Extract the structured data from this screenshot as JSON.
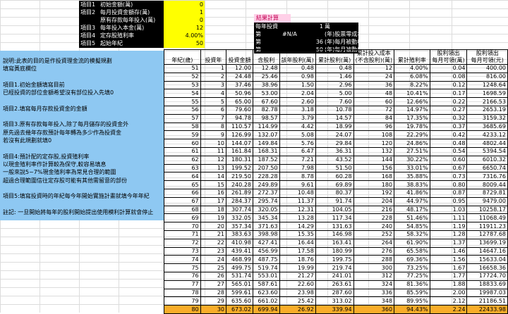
{
  "params": [
    {
      "label": "項目1",
      "name": "初始金額(萬)",
      "value": "0"
    },
    {
      "label": "項目2",
      "name": "每月投資金額存(萬)",
      "value": "1"
    },
    {
      "label": "",
      "name": "原有存款每年投入(萬)",
      "value": "0"
    },
    {
      "label": "項目3",
      "name": "每年投入本金(萬)",
      "value": "12"
    },
    {
      "label": "項目4",
      "name": "定存股殖利率",
      "value": "4.00%"
    },
    {
      "label": "項目5",
      "name": "起始年紀",
      "value": "50"
    }
  ],
  "result": {
    "title": "結果計算",
    "rows": [
      {
        "c1": "每年投資",
        "c2": "",
        "c3": "1",
        "c4": "萬"
      },
      {
        "c1": "第",
        "c2": "#N/A",
        "c3": "",
        "c4": "(年)股票零成本"
      },
      {
        "c1": "第",
        "c2": "",
        "c3": "36",
        "c4": "(年)每月被動收入大於3萬"
      },
      {
        "c1": "第",
        "c2": "",
        "c3": "50",
        "c4": "(年)每月被動收入大於5萬"
      }
    ]
  },
  "notes": [
    "說明:此表的目的是作投資理金流的模擬規劃",
    "填寫黃底欄位",
    "",
    "項目1.初始金額填寫目前",
    "已經投資的部位金額希望沒有部位投入先填0",
    "",
    "項目2.填寫每月存款投資金的金額",
    "",
    "項目3.原有存款每年投入,除了每月儲存的投資金外",
    "原先過去幾年存款預計每年轉為多少作為投資金",
    "若沒有此規劃就填0",
    "",
    "項目4:預計配的定存股,投資殖利率",
    "以現金殖利率作計算較為保守,較容易填息",
    "一般來說5~7%現金殖利率為常見合理的範圍",
    "超過合理範圍信往定存股可能有其他需留意的部份",
    "",
    "項目5:填寫投資時的年紀每今年開始實施計畫就填今年年紀",
    "",
    "註記: 一旦開始將每年的股利開始提出使用模利計算就會停止"
  ],
  "headers": [
    "年紀(歲)",
    "投資年",
    "投資金額",
    "含股利",
    "該年股利(萬)",
    "累計股利(萬)",
    "累計投入成本\n(不含股利)(萬)",
    "累計殖利率",
    "股利領出\n每月可領(萬)",
    "股利領出\n每月可領(元)"
  ],
  "rows": [
    [
      "51",
      "1",
      "12.00",
      "12.48",
      "0.48",
      "0.48",
      "12",
      "4.00%",
      "0.04",
      "400.00"
    ],
    [
      "52",
      "2",
      "24.48",
      "25.46",
      "0.98",
      "1.46",
      "24",
      "6.08%",
      "0.08",
      "816.00"
    ],
    [
      "53",
      "3",
      "37.46",
      "38.96",
      "1.50",
      "2.96",
      "36",
      "8.22%",
      "0.12",
      "1248.64"
    ],
    [
      "54",
      "4",
      "50.96",
      "53.00",
      "2.04",
      "5.00",
      "48",
      "10.41%",
      "0.17",
      "1698.59"
    ],
    [
      "55",
      "5",
      "65.00",
      "67.60",
      "2.60",
      "7.60",
      "60",
      "12.66%",
      "0.22",
      "2166.53"
    ],
    [
      "56",
      "6",
      "79.60",
      "82.78",
      "3.18",
      "10.78",
      "72",
      "14.97%",
      "0.27",
      "2653.19"
    ],
    [
      "57",
      "7",
      "94.78",
      "98.57",
      "3.79",
      "14.57",
      "84",
      "17.35%",
      "0.32",
      "3159.32"
    ],
    [
      "58",
      "8",
      "110.57",
      "114.99",
      "4.42",
      "18.99",
      "96",
      "19.78%",
      "0.37",
      "3685.69"
    ],
    [
      "59",
      "9",
      "126.99",
      "132.07",
      "5.08",
      "24.07",
      "108",
      "22.29%",
      "0.42",
      "4233.12"
    ],
    [
      "60",
      "10",
      "144.07",
      "149.84",
      "5.76",
      "29.84",
      "120",
      "24.86%",
      "0.48",
      "4802.44"
    ],
    [
      "61",
      "11",
      "161.84",
      "168.31",
      "6.47",
      "36.31",
      "132",
      "27.51%",
      "0.54",
      "5394.54"
    ],
    [
      "62",
      "12",
      "180.31",
      "187.52",
      "7.21",
      "43.52",
      "144",
      "30.22%",
      "0.60",
      "6010.32"
    ],
    [
      "63",
      "13",
      "199.52",
      "207.50",
      "7.98",
      "51.50",
      "156",
      "33.01%",
      "0.67",
      "6650.74"
    ],
    [
      "64",
      "14",
      "219.50",
      "228.28",
      "8.78",
      "60.28",
      "168",
      "35.88%",
      "0.73",
      "7316.76"
    ],
    [
      "65",
      "15",
      "240.28",
      "249.89",
      "9.61",
      "69.89",
      "180",
      "38.83%",
      "0.80",
      "8009.44"
    ],
    [
      "66",
      "16",
      "261.89",
      "272.37",
      "10.48",
      "80.37",
      "192",
      "41.86%",
      "0.87",
      "8729.81"
    ],
    [
      "67",
      "17",
      "284.37",
      "295.74",
      "11.37",
      "91.74",
      "204",
      "44.97%",
      "0.95",
      "9479.00"
    ],
    [
      "68",
      "18",
      "307.74",
      "320.05",
      "12.31",
      "104.05",
      "216",
      "48.17%",
      "1.03",
      "10258.17"
    ],
    [
      "69",
      "19",
      "332.05",
      "345.34",
      "13.28",
      "117.34",
      "228",
      "51.46%",
      "1.11",
      "11068.49"
    ],
    [
      "70",
      "20",
      "357.34",
      "371.63",
      "14.29",
      "131.63",
      "240",
      "54.85%",
      "1.19",
      "11911.23"
    ],
    [
      "71",
      "21",
      "383.63",
      "398.98",
      "15.35",
      "146.98",
      "252",
      "58.32%",
      "1.28",
      "12787.68"
    ],
    [
      "72",
      "22",
      "410.98",
      "427.41",
      "16.44",
      "163.41",
      "264",
      "61.90%",
      "1.37",
      "13699.19"
    ],
    [
      "73",
      "23",
      "439.41",
      "456.99",
      "17.58",
      "180.99",
      "276",
      "65.58%",
      "1.46",
      "14647.16"
    ],
    [
      "74",
      "24",
      "468.99",
      "487.75",
      "18.76",
      "199.75",
      "288",
      "69.36%",
      "1.56",
      "15633.04"
    ],
    [
      "75",
      "25",
      "499.75",
      "519.74",
      "19.99",
      "219.74",
      "300",
      "73.25%",
      "1.67",
      "16658.36"
    ],
    [
      "76",
      "26",
      "531.74",
      "553.01",
      "21.27",
      "241.01",
      "312",
      "77.25%",
      "1.77",
      "17724.70"
    ],
    [
      "77",
      "27",
      "565.01",
      "587.61",
      "22.60",
      "263.61",
      "324",
      "81.36%",
      "1.88",
      "18833.69"
    ],
    [
      "78",
      "28",
      "599.61",
      "623.60",
      "23.98",
      "287.60",
      "336",
      "85.59%",
      "2.00",
      "19987.03"
    ],
    [
      "79",
      "29",
      "635.60",
      "661.02",
      "25.42",
      "313.02",
      "348",
      "89.95%",
      "2.12",
      "21186.51"
    ],
    [
      "80",
      "30",
      "673.02",
      "699.94",
      "26.92",
      "339.94",
      "360",
      "94.43%",
      "2.24",
      "22433.98"
    ]
  ]
}
